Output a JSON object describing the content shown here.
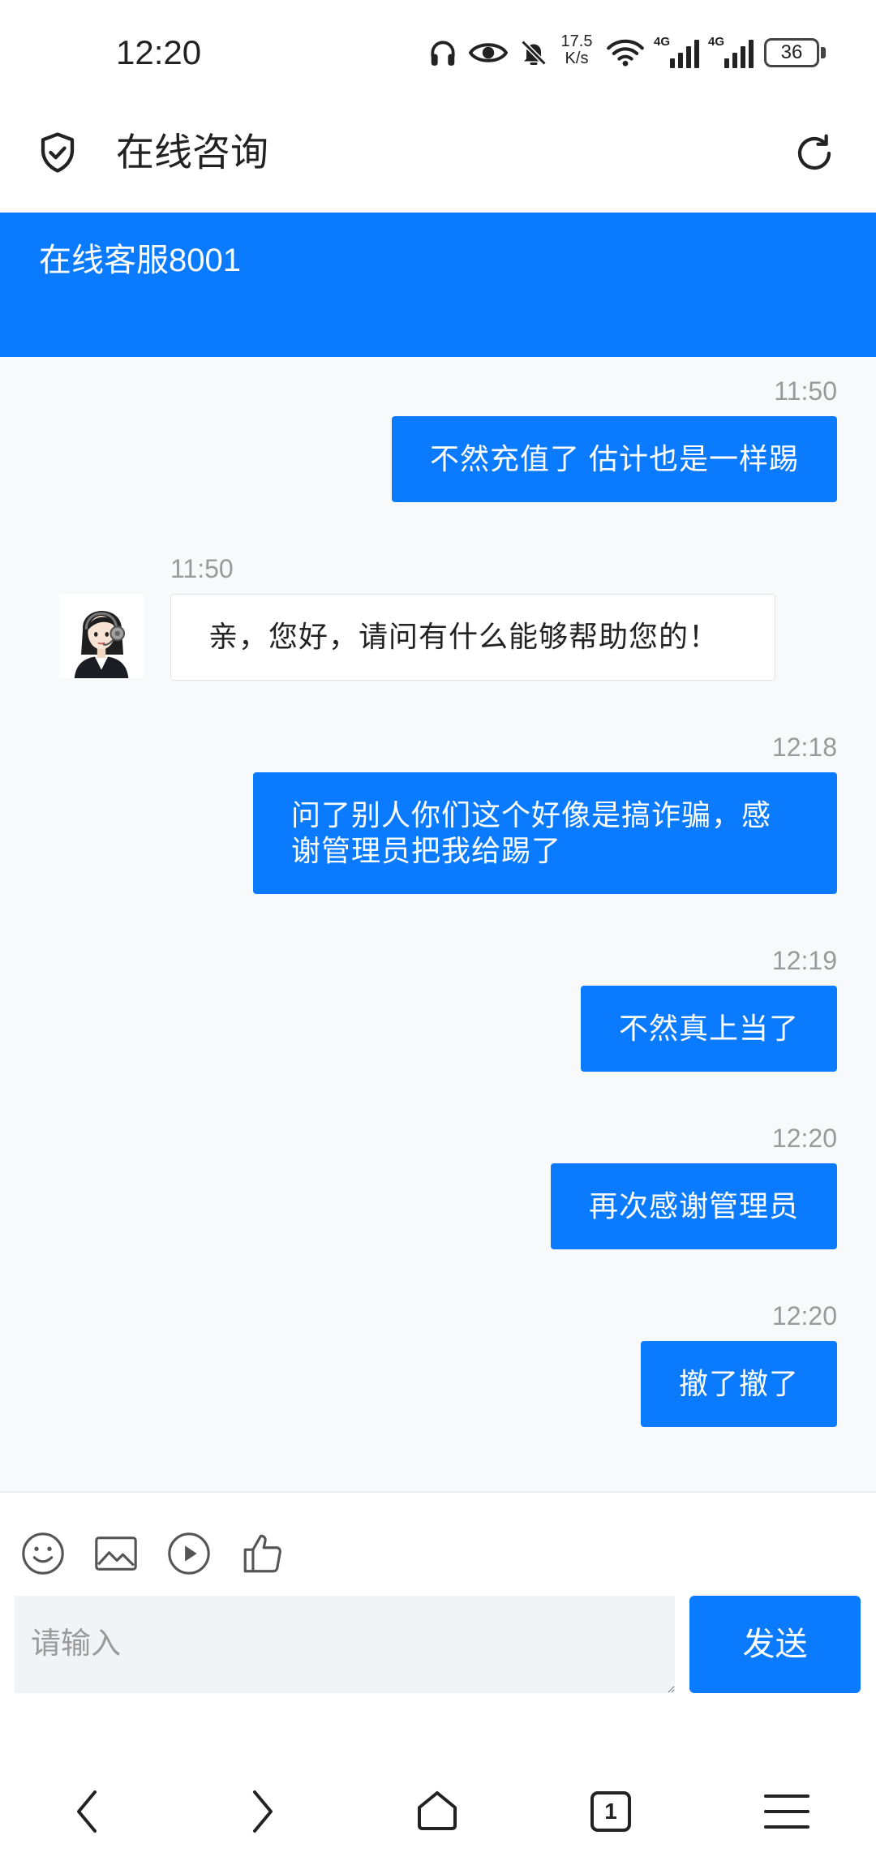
{
  "status_bar": {
    "time": "12:20",
    "net_speed_value": "17.5",
    "net_speed_unit": "K/s",
    "network_1": "4G",
    "network_2": "4G",
    "battery": "36"
  },
  "header": {
    "title": "在线咨询"
  },
  "banner": {
    "agent_name": "在线客服8001"
  },
  "messages": [
    {
      "time": "11:50",
      "text": "不然充值了 估计也是一样踢"
    },
    {
      "time": "11:50",
      "text": "亲，您好，请问有什么能够帮助您的！"
    },
    {
      "time": "12:18",
      "text": "问了别人你们这个好像是搞诈骗，感谢管理员把我给踢了"
    },
    {
      "time": "12:19",
      "text": "不然真上当了"
    },
    {
      "time": "12:20",
      "text": "再次感谢管理员"
    },
    {
      "time": "12:20",
      "text": "撤了撤了"
    }
  ],
  "input": {
    "placeholder": "请输入",
    "value": ""
  },
  "send_button": {
    "label": "发送"
  },
  "bottom_nav": {
    "tab_count": "1"
  },
  "colors": {
    "accent": "#0A7BFF",
    "chat_background": "#F8F9FA",
    "incoming_bubble": "#FFFFFF",
    "timestamp": "#9A9A9A"
  }
}
